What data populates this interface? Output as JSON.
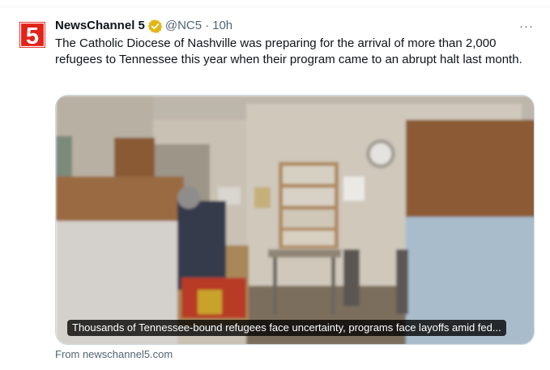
{
  "tweet": {
    "display_name": "NewsChannel 5",
    "verified_icon": "verified-badge-icon",
    "handle": "@NC5",
    "separator": "·",
    "time": "10h",
    "more_icon": "more-horizontal-icon",
    "more_label": "···",
    "avatar_label": "5",
    "text": "The Catholic Diocese of Nashville was preparing for the arrival of more than 2,000 refugees to Tennessee this year when their program came to an abrupt halt last month."
  },
  "card": {
    "title": "Thousands of Tennessee-bound refugees face uncertainty, programs face layoffs amid fed...",
    "source": "From newschannel5.com"
  },
  "colors": {
    "brand_red": "#e2231a",
    "verified_gold": "#e2b719",
    "secondary_text": "#536471",
    "border": "#cfd9de"
  }
}
